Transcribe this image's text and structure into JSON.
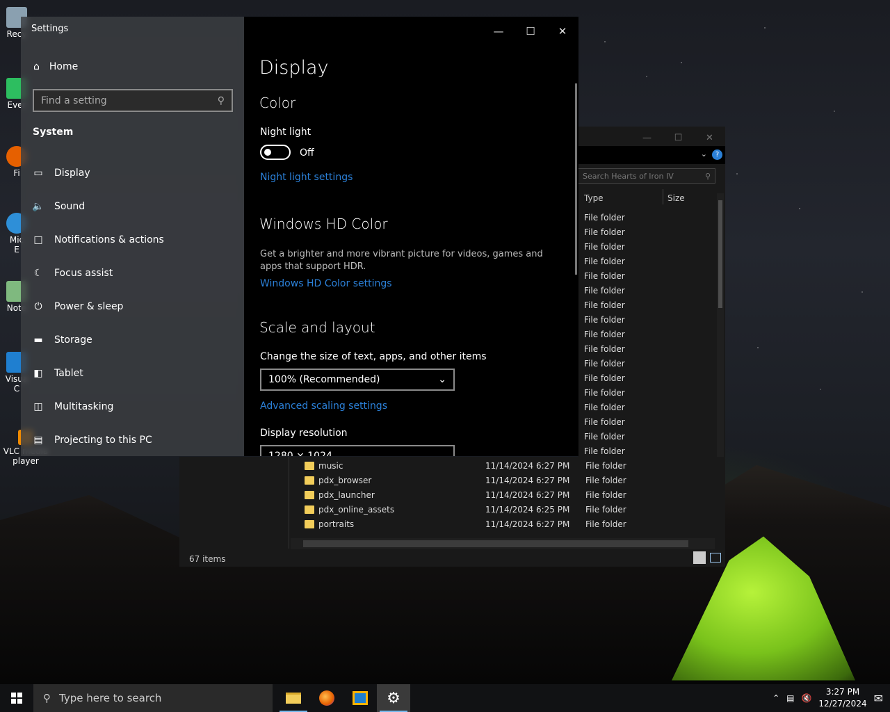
{
  "desktop": {
    "icons": [
      {
        "label": "Recy"
      },
      {
        "label": "Ever"
      },
      {
        "label": "Fi"
      },
      {
        "label": "Mic\nE"
      },
      {
        "label": "Note"
      },
      {
        "label": "Visua\nC"
      },
      {
        "label": "VLC media\nplayer"
      }
    ]
  },
  "settings": {
    "title": "Settings",
    "home": "Home",
    "search_placeholder": "Find a setting",
    "section": "System",
    "nav": [
      {
        "label": "Display",
        "icon": "monitor-icon"
      },
      {
        "label": "Sound",
        "icon": "speaker-icon"
      },
      {
        "label": "Notifications & actions",
        "icon": "notification-icon"
      },
      {
        "label": "Focus assist",
        "icon": "moon-icon"
      },
      {
        "label": "Power & sleep",
        "icon": "power-icon"
      },
      {
        "label": "Storage",
        "icon": "storage-icon"
      },
      {
        "label": "Tablet",
        "icon": "tablet-icon"
      },
      {
        "label": "Multitasking",
        "icon": "multitasking-icon"
      },
      {
        "label": "Projecting to this PC",
        "icon": "project-icon"
      }
    ],
    "page_title": "Display",
    "color_heading": "Color",
    "night_light_label": "Night light",
    "night_light_state": "Off",
    "night_light_link": "Night light settings",
    "hd_heading": "Windows HD Color",
    "hd_desc": "Get a brighter and more vibrant picture for videos, games and apps that support HDR.",
    "hd_link": "Windows HD Color settings",
    "scale_heading": "Scale and layout",
    "scale_label": "Change the size of text, apps, and other items",
    "scale_value": "100% (Recommended)",
    "advanced_link": "Advanced scaling settings",
    "resolution_label": "Display resolution",
    "resolution_value": "1280 × 1024"
  },
  "explorer": {
    "search_placeholder": "Search Hearts of Iron IV",
    "columns": {
      "type": "Type",
      "size": "Size"
    },
    "type_values": [
      "File folder",
      "File folder",
      "File folder",
      "File folder",
      "File folder",
      "File folder",
      "File folder",
      "File folder",
      "File folder",
      "File folder",
      "File folder",
      "File folder",
      "File folder",
      "File folder",
      "File folder",
      "File folder",
      "File folder"
    ],
    "rows": [
      {
        "name": "music",
        "date": "11/14/2024 6:27 PM",
        "type": "File folder"
      },
      {
        "name": "pdx_browser",
        "date": "11/14/2024 6:27 PM",
        "type": "File folder"
      },
      {
        "name": "pdx_launcher",
        "date": "11/14/2024 6:27 PM",
        "type": "File folder"
      },
      {
        "name": "pdx_online_assets",
        "date": "11/14/2024 6:25 PM",
        "type": "File folder"
      },
      {
        "name": "portraits",
        "date": "11/14/2024 6:27 PM",
        "type": "File folder"
      }
    ],
    "status": "67 items"
  },
  "taskbar": {
    "search_placeholder": "Type here to search",
    "time": "3:27 PM",
    "date": "12/27/2024"
  }
}
